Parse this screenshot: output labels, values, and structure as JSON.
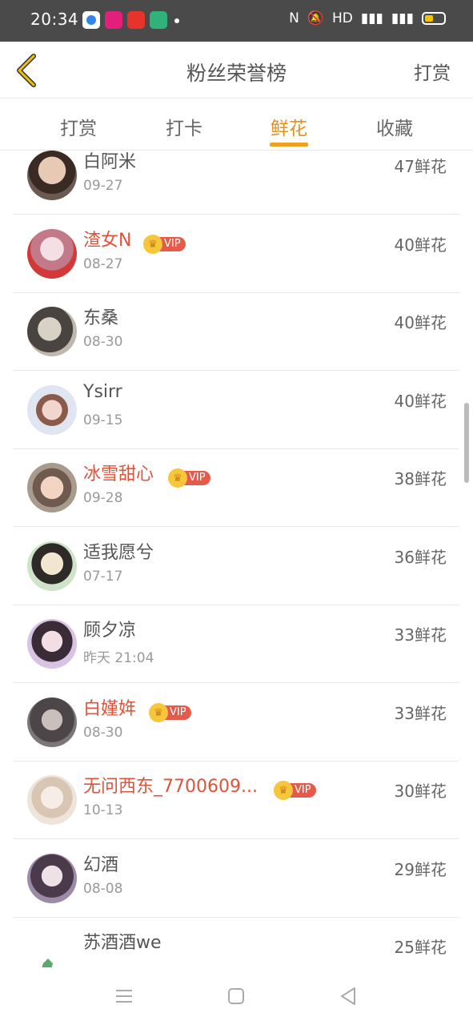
{
  "status": {
    "time": "20:34",
    "right": "HD"
  },
  "header": {
    "title": "粉丝荣誉榜",
    "action": "打赏"
  },
  "tabs": [
    "打赏",
    "打卡",
    "鲜花",
    "收藏"
  ],
  "active_tab": 2,
  "vip_label": "VIP",
  "items": [
    {
      "name": "白阿米",
      "date": "09-27",
      "count": "47鲜花",
      "vip": false
    },
    {
      "name": "渣女N",
      "date": "08-27",
      "count": "40鲜花",
      "vip": true
    },
    {
      "name": "东桑",
      "date": "08-30",
      "count": "40鲜花",
      "vip": false
    },
    {
      "name": "Ysirr",
      "date": "09-15",
      "count": "40鲜花",
      "vip": false
    },
    {
      "name": "冰雪甜心",
      "date": "09-28",
      "count": "38鲜花",
      "vip": true
    },
    {
      "name": "适我愿兮",
      "date": "07-17",
      "count": "36鲜花",
      "vip": false
    },
    {
      "name": "顾夕凉",
      "date": "昨天 21:04",
      "count": "33鲜花",
      "vip": false
    },
    {
      "name": "白嫤姩",
      "date": "08-30",
      "count": "33鲜花",
      "vip": true
    },
    {
      "name": "无问西东_7700609...",
      "date": "10-13",
      "count": "30鲜花",
      "vip": true
    },
    {
      "name": "幻酒",
      "date": "08-08",
      "count": "29鲜花",
      "vip": false
    },
    {
      "name": "苏酒酒we",
      "date": "",
      "count": "25鲜花",
      "vip": false
    }
  ],
  "colors": {
    "accent": "#f0a020",
    "vip_name": "#e0533a",
    "vip_badge": "#e55b4b",
    "statusbar": "#4a4a4a"
  }
}
